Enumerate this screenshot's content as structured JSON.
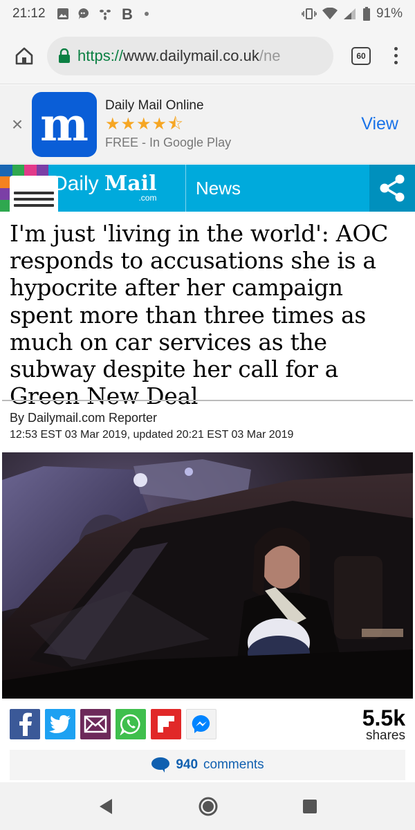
{
  "status_bar": {
    "time": "21:12",
    "notification_icons": [
      "image-icon",
      "chat-bubble-icon",
      "fan-icon",
      "b-icon",
      "dot-icon"
    ],
    "battery": "91%"
  },
  "browser": {
    "url_scheme": "https://",
    "url_host": "www.dailymail.co.uk",
    "url_rest": "/ne",
    "tab_count": "60"
  },
  "app_banner": {
    "app_name": "Daily Mail Online",
    "rating": 4.5,
    "rating_stars": "★★★★⯪",
    "subtitle": "FREE - In Google Play",
    "view_label": "View",
    "close_label": "×"
  },
  "site_header": {
    "brand_daily": "Daily",
    "brand_mail": "Mail",
    "brand_com": ".com",
    "section": "News",
    "colors": {
      "header": "#00aadc",
      "share_bg": "#0090bd"
    }
  },
  "article": {
    "headline": "I'm just 'living in the world': AOC responds to accusations she is a hypocrite after her campaign spent more than three times as much on car services as the subway despite her call for a Green New Deal",
    "byline": "By Dailymail.com Reporter",
    "dateline": "12:53 EST 03 Mar 2019, updated 20:21 EST 03 Mar 2019"
  },
  "share": {
    "buttons": [
      "facebook",
      "twitter",
      "email",
      "whatsapp",
      "flipboard",
      "messenger"
    ],
    "count": "5.5k",
    "count_label": "shares"
  },
  "comments": {
    "count": "940",
    "label": "comments"
  }
}
